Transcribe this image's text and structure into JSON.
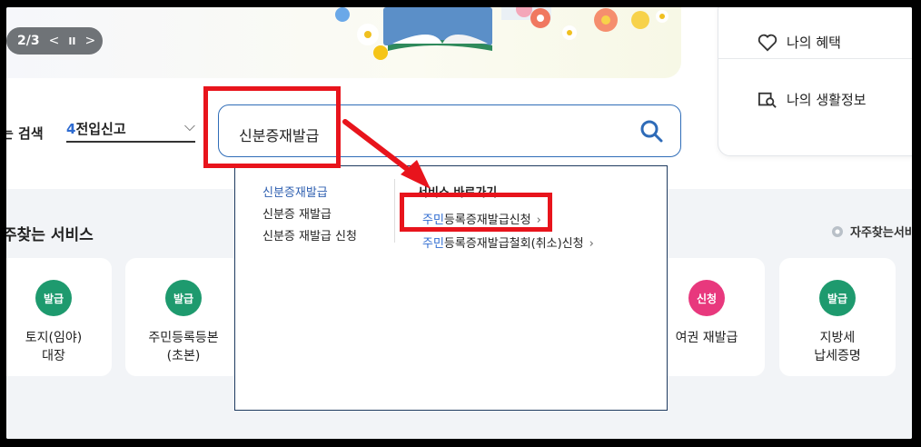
{
  "banner": {
    "pager": {
      "current_total": "2/3",
      "prev": "<",
      "pause": "II",
      "next": ">"
    }
  },
  "right_panel": {
    "items": [
      {
        "label": "나의 혜택",
        "icon": "heart-icon"
      },
      {
        "label": "나의 생활정보",
        "icon": "search-doc-icon"
      }
    ]
  },
  "search": {
    "label": "는 검색",
    "select": {
      "num": "4",
      "text": "전입신고"
    },
    "value": "신분증재발급",
    "icon": "search-icon"
  },
  "dropdown": {
    "suggestions": [
      "신분증재발급",
      "신분증 재발급",
      "신분증 재발급 신청"
    ],
    "shortcut_title": "서비스 바로가기",
    "shortcuts": [
      {
        "blue": "주민",
        "rest": "등록증재발급신청"
      },
      {
        "blue": "주민",
        "rest": "등록증재발급철회(취소)신청"
      }
    ]
  },
  "frequent": {
    "title": "주찾는 서비스",
    "more": "자주찾는서비",
    "cards": [
      {
        "badge": "발급",
        "label1": "토지(임야)",
        "label2": "대장",
        "color": "#1e9a6e"
      },
      {
        "badge": "발급",
        "label1": "주민등록등본",
        "label2": "(초본)",
        "color": "#1e9a6e"
      },
      {
        "badge": "신청",
        "label1": "여권 재발급",
        "label2": "",
        "color": "#e8387d"
      },
      {
        "badge": "발급",
        "label1": "지방세",
        "label2": "납세증명",
        "color": "#1e9a6e"
      }
    ]
  },
  "annotation_color": "#e8141c"
}
